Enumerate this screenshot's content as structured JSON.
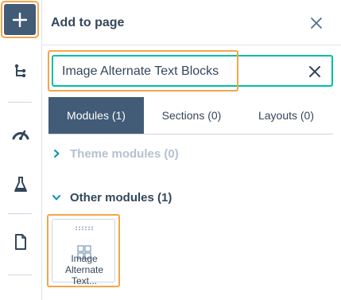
{
  "colors": {
    "rail_active": "#425b76",
    "highlight": "#f5a54a",
    "search_focus": "#00bda5",
    "text": "#33475b",
    "muted": "#b4c1d0"
  },
  "rail": {
    "items": [
      {
        "name": "add-icon",
        "active": true
      },
      {
        "name": "tree-structure-icon"
      },
      {
        "name": "speedometer-icon"
      },
      {
        "name": "flask-icon"
      },
      {
        "name": "document-icon"
      }
    ]
  },
  "panel": {
    "title": "Add to page",
    "search": {
      "value": "Image Alternate Text Blocks"
    },
    "tabs": [
      {
        "label": "Modules (1)",
        "active": true
      },
      {
        "label": "Sections (0)",
        "active": false
      },
      {
        "label": "Layouts (0)",
        "active": false
      }
    ],
    "groups": [
      {
        "label": "Theme modules (0)",
        "expanded": false
      },
      {
        "label": "Other modules (1)",
        "expanded": true
      }
    ],
    "module_card": {
      "label": "Image Alternate Text..."
    }
  }
}
